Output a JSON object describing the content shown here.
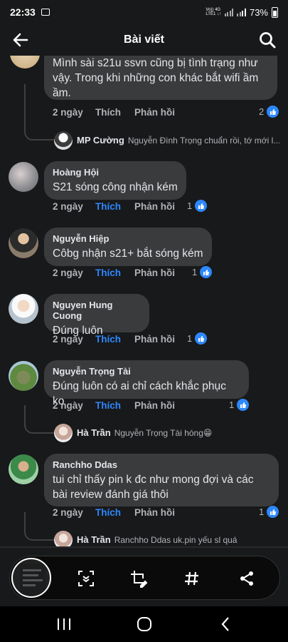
{
  "status_bar": {
    "time": "22:33",
    "network_top": "Vo)) 4G",
    "network_bottom": "LTE1 ↓↑",
    "battery": "73%"
  },
  "header": {
    "title": "Bài viết"
  },
  "comments": [
    {
      "name": "",
      "text": "Mình sài s21u ssvn cũng bị tình trạng như vậy. Trong khi những con khác bắt wifi ầm ầm.",
      "time": "2 ngày",
      "like_label": "Thích",
      "reply_label": "Phản hồi",
      "reaction_count": "2",
      "liked": false,
      "reply": {
        "name": "MP Cường",
        "text": "Nguyễn Đình Trọng chuẩn rồi, tớ mới l..."
      }
    },
    {
      "name": "Hoàng Hội",
      "text": "S21 sóng công nhận kém",
      "time": "2 ngày",
      "like_label": "Thích",
      "reply_label": "Phản hồi",
      "reaction_count": "1",
      "liked": true
    },
    {
      "name": "Nguyễn Hiệp",
      "text": "Côbg nhận s21+ bắt sóng kém",
      "time": "2 ngày",
      "like_label": "Thích",
      "reply_label": "Phản hồi",
      "reaction_count": "1",
      "liked": true
    },
    {
      "name": "Nguyen Hung Cuong",
      "text": "Đúng luôn",
      "time": "2 ngày",
      "like_label": "Thích",
      "reply_label": "Phản hồi",
      "reaction_count": "1",
      "liked": true
    },
    {
      "name": "Nguyễn Trọng Tài",
      "text": "Đúng luôn có ai chỉ cách khắc phục ko",
      "time": "2 ngày",
      "like_label": "Thích",
      "reply_label": "Phản hồi",
      "reaction_count": "1",
      "liked": true,
      "reply": {
        "name": "Hà Trần",
        "text": "Nguyễn Trọng Tài hóng😁"
      }
    },
    {
      "name": "Ranchho Ddas",
      "text": "tui chỉ thấy pin k đc như mong đợi và các bài review đánh giá thôi",
      "time": "2 ngày",
      "like_label": "Thích",
      "reply_label": "Phản hồi",
      "reaction_count": "1",
      "liked": true,
      "reply": {
        "name": "Hà Trần",
        "text": "Ranchho Ddas uk.pin yếu sl quá"
      }
    }
  ],
  "colors": {
    "background": "#18191a",
    "bubble": "#3a3b3c",
    "accent": "#2d88ff",
    "muted": "#b0b3b8"
  }
}
